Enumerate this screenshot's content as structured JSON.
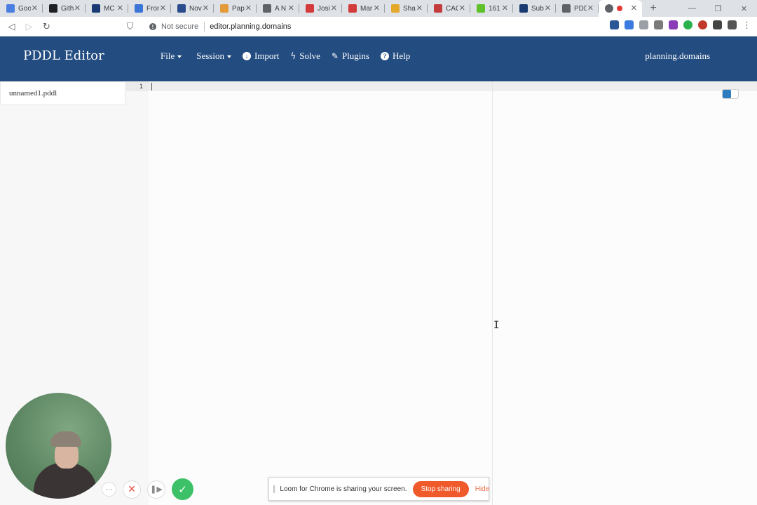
{
  "browser": {
    "tabs": [
      {
        "title": "Goo",
        "color": "#4a7ee0"
      },
      {
        "title": "Gith",
        "color": "#202124"
      },
      {
        "title": "MC",
        "color": "#1a3b72"
      },
      {
        "title": "Fron",
        "color": "#3b75d6"
      },
      {
        "title": "Nov",
        "color": "#2b4c8c"
      },
      {
        "title": "Pap",
        "color": "#e59a3a"
      },
      {
        "title": "A N",
        "color": "#5f6368"
      },
      {
        "title": "Josi",
        "color": "#d33a3a"
      },
      {
        "title": "Mar",
        "color": "#d33a3a"
      },
      {
        "title": "Sha",
        "color": "#e4a92a"
      },
      {
        "title": "CAC",
        "color": "#c43b3b"
      },
      {
        "title": "161",
        "color": "#5fc12a"
      },
      {
        "title": "Sub",
        "color": "#1a3b72"
      },
      {
        "title": "PDD",
        "color": "#5f6368"
      },
      {
        "title": "",
        "color": "#5f6368"
      }
    ],
    "new_tab": "+",
    "window_controls": {
      "minimize": "—",
      "restore": "❐",
      "close": "✕"
    },
    "nav": {
      "back": "◁",
      "forward": "▷",
      "reload": "↻",
      "bookmark": "⛉"
    },
    "security_label": "Not secure",
    "url": "editor.planning.domains",
    "extensions": [
      "#2b5797",
      "#3b7be0",
      "#9aa0a6",
      "#7a7a7a",
      "#8a3bb7",
      "#2bb24c",
      "#c0392b",
      "#444444",
      "#555555"
    ]
  },
  "app": {
    "brand": "PDDL Editor",
    "menu": [
      {
        "label": "File",
        "icon": "file-icon",
        "dropdown": true
      },
      {
        "label": "Session",
        "icon": "cloud-icon",
        "dropdown": true
      },
      {
        "label": "Import",
        "icon": "download-circle-icon",
        "dropdown": false
      },
      {
        "label": "Solve",
        "icon": "bolt-icon",
        "dropdown": false
      },
      {
        "label": "Plugins",
        "icon": "wrench-icon",
        "dropdown": false
      },
      {
        "label": "Help",
        "icon": "question-circle-icon",
        "dropdown": false
      }
    ],
    "site_link": "planning.domains",
    "colors": {
      "nav_bg": "#234c80",
      "toggle_accent": "#2f7bbf"
    }
  },
  "sidebar": {
    "files": [
      "unnamed1.pddl"
    ]
  },
  "editor": {
    "line_numbers": [
      "1"
    ],
    "content": ""
  },
  "loom": {
    "message": "Loom for Chrome is sharing your screen.",
    "stop_label": "Stop sharing",
    "hide_label": "Hide",
    "colors": {
      "stop": "#f05a2b",
      "done": "#3cc168"
    }
  }
}
